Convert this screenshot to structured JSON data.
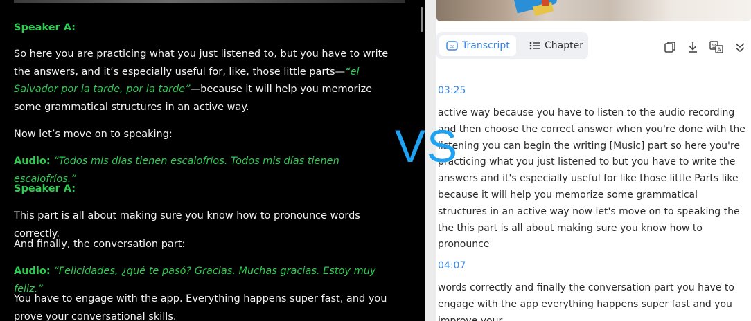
{
  "left": {
    "blocks": [
      {
        "type": "speaker",
        "label": "Speaker A:"
      },
      {
        "type": "text",
        "before": "So here you are practicing what you just listened to, but you have to write the answers, and it’s especially useful for, like, those little parts—",
        "italic": "“el Salvador por la tarde, por la tarde”",
        "after": "—because it will help you memorize some grammatical structures in an active way."
      },
      {
        "type": "plain",
        "text": "Now let’s move on to speaking:"
      },
      {
        "type": "audio",
        "label": "Audio:",
        "quote": "“Todos mis días tienen escalofríos. Todos mis días tienen escalofríos.”"
      },
      {
        "type": "speaker",
        "label": "Speaker A:"
      },
      {
        "type": "plain",
        "text": "This part is all about making sure you know how to pronounce words correctly."
      },
      {
        "type": "plain",
        "text": "And finally, the conversation part:"
      },
      {
        "type": "audio",
        "label": "Audio:",
        "quote": "“Felicidades, ¿qué te pasó? Gracias. Muchas gracias. Estoy muy feliz.”"
      },
      {
        "type": "plain",
        "text": "You have to engage with the app. Everything happens super fast, and you prove your conversational skills."
      }
    ]
  },
  "overlay": {
    "vs": "VS"
  },
  "right": {
    "tabs": [
      {
        "label": "Transcript",
        "icon": "cc-icon",
        "active": true
      },
      {
        "label": "Chapter",
        "icon": "list-icon",
        "active": false
      }
    ],
    "toolbar": [
      "copy-icon",
      "download-icon",
      "translate-icon",
      "collapse-icon"
    ],
    "segments": [
      {
        "time": "03:25",
        "text": "active way because you have to listen  to the audio recording and then choose the correct answer when you're done with  the listening you can begin the writing [Music] part so here you're practicing what  you just listened to but you have to write the answers and it's especially  useful for like those little Parts like because it will help you memorize some grammatical structures in an active  way now let's move on to speaking the the this part is all about making  sure you know how to pronounce"
      },
      {
        "time": "04:07",
        "text": "words correctly and finally the conversation part you have to engage with the app  everything happens super fast and you improve your"
      }
    ]
  },
  "colors": {
    "accent_green": "#2ecc52",
    "accent_blue": "#3a86e0",
    "vs_blue": "#1ea2f1"
  }
}
